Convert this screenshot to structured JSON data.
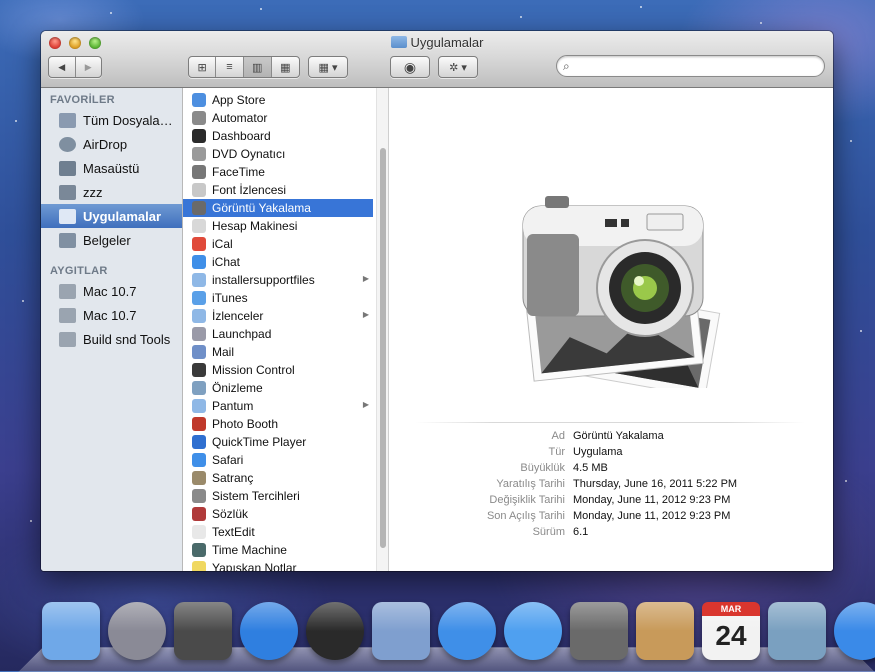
{
  "window": {
    "title": "Uygulamalar",
    "search_placeholder": ""
  },
  "toolbar": {
    "back": "◀",
    "forward": "▶",
    "view_icons": "⊞",
    "view_list": "≡",
    "view_columns": "▥",
    "view_coverflow": "▦",
    "arrange": "▦ ▾",
    "quicklook": "◉",
    "action": "✲ ▾"
  },
  "sidebar": {
    "favorites_header": "FAVORİLER",
    "devices_header": "AYGITLAR",
    "favorites": [
      {
        "label": "Tüm Dosyala…",
        "icon": "all-files-icon"
      },
      {
        "label": "AirDrop",
        "icon": "airdrop-icon"
      },
      {
        "label": "Masaüstü",
        "icon": "desktop-icon"
      },
      {
        "label": "zzz",
        "icon": "home-icon"
      },
      {
        "label": "Uygulamalar",
        "icon": "applications-icon"
      },
      {
        "label": "Belgeler",
        "icon": "documents-icon"
      }
    ],
    "devices": [
      {
        "label": "Mac 10.7",
        "icon": "disk-icon"
      },
      {
        "label": "Mac 10.7",
        "icon": "disk-icon"
      },
      {
        "label": "Build snd Tools",
        "icon": "disk-icon"
      }
    ]
  },
  "files": [
    {
      "label": "App Store",
      "icon": "#4d8fe0"
    },
    {
      "label": "Automator",
      "icon": "#8a8a8a"
    },
    {
      "label": "Dashboard",
      "icon": "#2a2a2a"
    },
    {
      "label": "DVD Oynatıcı",
      "icon": "#9a9a9a"
    },
    {
      "label": "FaceTime",
      "icon": "#777777"
    },
    {
      "label": "Font İzlencesi",
      "icon": "#c8c8c8"
    },
    {
      "label": "Görüntü Yakalama",
      "icon": "#6a6a6a"
    },
    {
      "label": "Hesap Makinesi",
      "icon": "#d8d8d8"
    },
    {
      "label": "iCal",
      "icon": "#e04a3a"
    },
    {
      "label": "iChat",
      "icon": "#3f8fe8"
    },
    {
      "label": "installersupportfiles",
      "icon": "#8fb8e6",
      "folder": true
    },
    {
      "label": "iTunes",
      "icon": "#5aa0e8"
    },
    {
      "label": "İzlenceler",
      "icon": "#8fb8e6",
      "folder": true
    },
    {
      "label": "Launchpad",
      "icon": "#9a9aa8"
    },
    {
      "label": "Mail",
      "icon": "#6f8fc8"
    },
    {
      "label": "Mission Control",
      "icon": "#3a3a3a"
    },
    {
      "label": "Önizleme",
      "icon": "#7fa0c0"
    },
    {
      "label": "Pantum",
      "icon": "#8fb8e6",
      "folder": true
    },
    {
      "label": "Photo Booth",
      "icon": "#c0392b"
    },
    {
      "label": "QuickTime Player",
      "icon": "#2f6fd0"
    },
    {
      "label": "Safari",
      "icon": "#3f8fe8"
    },
    {
      "label": "Satranç",
      "icon": "#9a8a6a"
    },
    {
      "label": "Sistem Tercihleri",
      "icon": "#8a8a8a"
    },
    {
      "label": "Sözlük",
      "icon": "#b03a3a"
    },
    {
      "label": "TextEdit",
      "icon": "#e8e8e8"
    },
    {
      "label": "Time Machine",
      "icon": "#4a6a6a"
    },
    {
      "label": "Yapışkan Notlar",
      "icon": "#f0d860"
    }
  ],
  "selected_file": "Görüntü Yakalama",
  "preview": {
    "info": [
      {
        "key": "Ad",
        "value": "Görüntü Yakalama"
      },
      {
        "key": "Tür",
        "value": "Uygulama"
      },
      {
        "key": "Büyüklük",
        "value": "4.5 MB"
      },
      {
        "key": "Yaratılış Tarihi",
        "value": "Thursday, June 16, 2011 5:22 PM"
      },
      {
        "key": "Değişiklik Tarihi",
        "value": "Monday, June 11, 2012 9:23 PM"
      },
      {
        "key": "Son Açılış Tarihi",
        "value": "Monday, June 11, 2012 9:23 PM"
      },
      {
        "key": "Sürüm",
        "value": "6.1"
      }
    ]
  },
  "dock": {
    "ical_month": "MAR",
    "ical_day": "24",
    "items": [
      {
        "name": "finder-icon",
        "color": "#6fa8e8"
      },
      {
        "name": "launchpad-icon",
        "color": "#8a8a96"
      },
      {
        "name": "mission-control-icon",
        "color": "#4a4a4a"
      },
      {
        "name": "app-store-icon",
        "color": "#2f7fe0"
      },
      {
        "name": "dashboard-icon",
        "color": "#2a2a2a"
      },
      {
        "name": "mail-icon",
        "color": "#7f9fcf"
      },
      {
        "name": "safari-icon",
        "color": "#3f8fe8"
      },
      {
        "name": "ichat-icon",
        "color": "#4fa0f0"
      },
      {
        "name": "facetime-icon",
        "color": "#6a6a6a"
      },
      {
        "name": "address-book-icon",
        "color": "#c89a5a"
      },
      {
        "name": "ical-icon",
        "color": "#f2f2f2"
      },
      {
        "name": "iphoto-icon",
        "color": "#7aa0c0"
      },
      {
        "name": "itunes-icon",
        "color": "#3a8ae8"
      }
    ]
  }
}
